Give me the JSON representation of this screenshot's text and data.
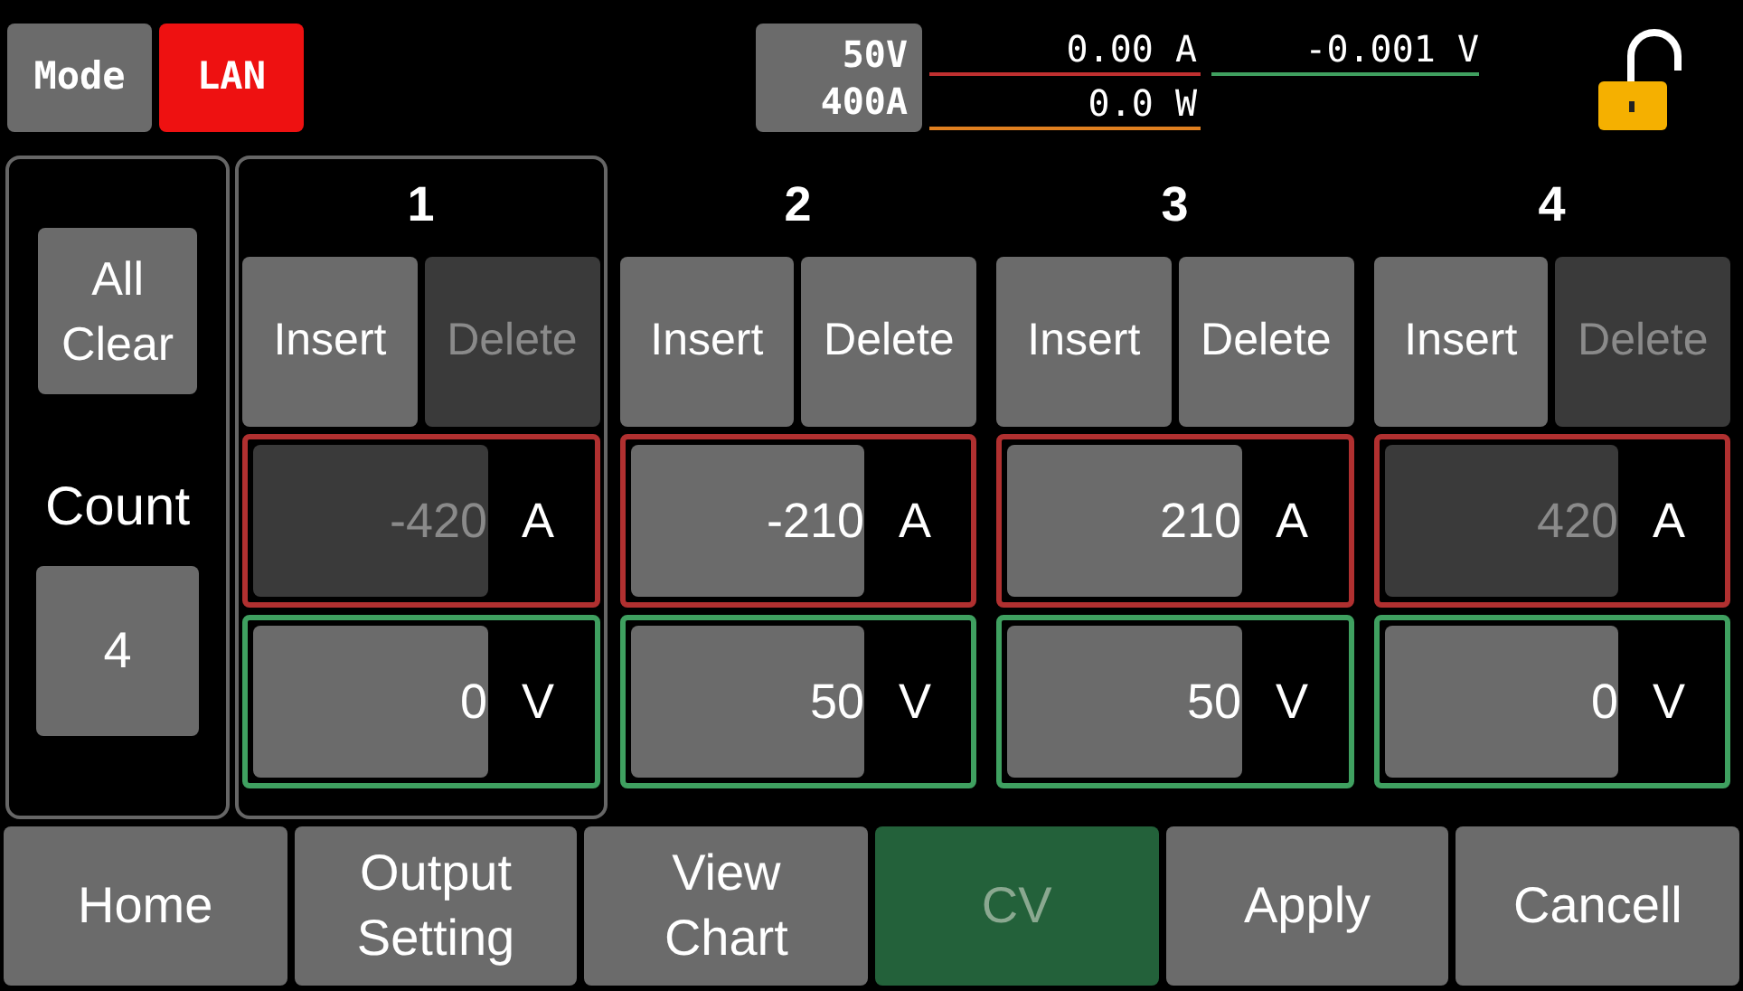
{
  "header": {
    "mode_button": "Mode",
    "interface_badge": "LAN",
    "range_voltage": "50V",
    "range_current": "400A",
    "current_reading": "0.00 A",
    "voltage_reading": "-0.001 V",
    "power_reading": "0.0 W",
    "locked": false
  },
  "sidebar": {
    "clear_button": "All Clear",
    "count_label": "Count",
    "count_value": "4"
  },
  "steps": [
    {
      "number": "1",
      "selected": true,
      "insert": "Insert",
      "delete": "Delete",
      "delete_disabled": true,
      "current": "-420",
      "current_unit": "A",
      "current_disabled": true,
      "voltage": "0",
      "voltage_unit": "V"
    },
    {
      "number": "2",
      "selected": false,
      "insert": "Insert",
      "delete": "Delete",
      "delete_disabled": false,
      "current": "-210",
      "current_unit": "A",
      "current_disabled": false,
      "voltage": "50",
      "voltage_unit": "V"
    },
    {
      "number": "3",
      "selected": false,
      "insert": "Insert",
      "delete": "Delete",
      "delete_disabled": false,
      "current": "210",
      "current_unit": "A",
      "current_disabled": false,
      "voltage": "50",
      "voltage_unit": "V"
    },
    {
      "number": "4",
      "selected": false,
      "insert": "Insert",
      "delete": "Delete",
      "delete_disabled": true,
      "current": "420",
      "current_unit": "A",
      "current_disabled": true,
      "voltage": "0",
      "voltage_unit": "V"
    }
  ],
  "bottom_bar": [
    {
      "label": "Home",
      "disabled": false
    },
    {
      "label": "Output\nSetting",
      "disabled": false
    },
    {
      "label": "View\nChart",
      "disabled": false
    },
    {
      "label": "CV",
      "disabled": true
    },
    {
      "label": "Apply",
      "disabled": false
    },
    {
      "label": "Cancell",
      "disabled": false
    }
  ]
}
